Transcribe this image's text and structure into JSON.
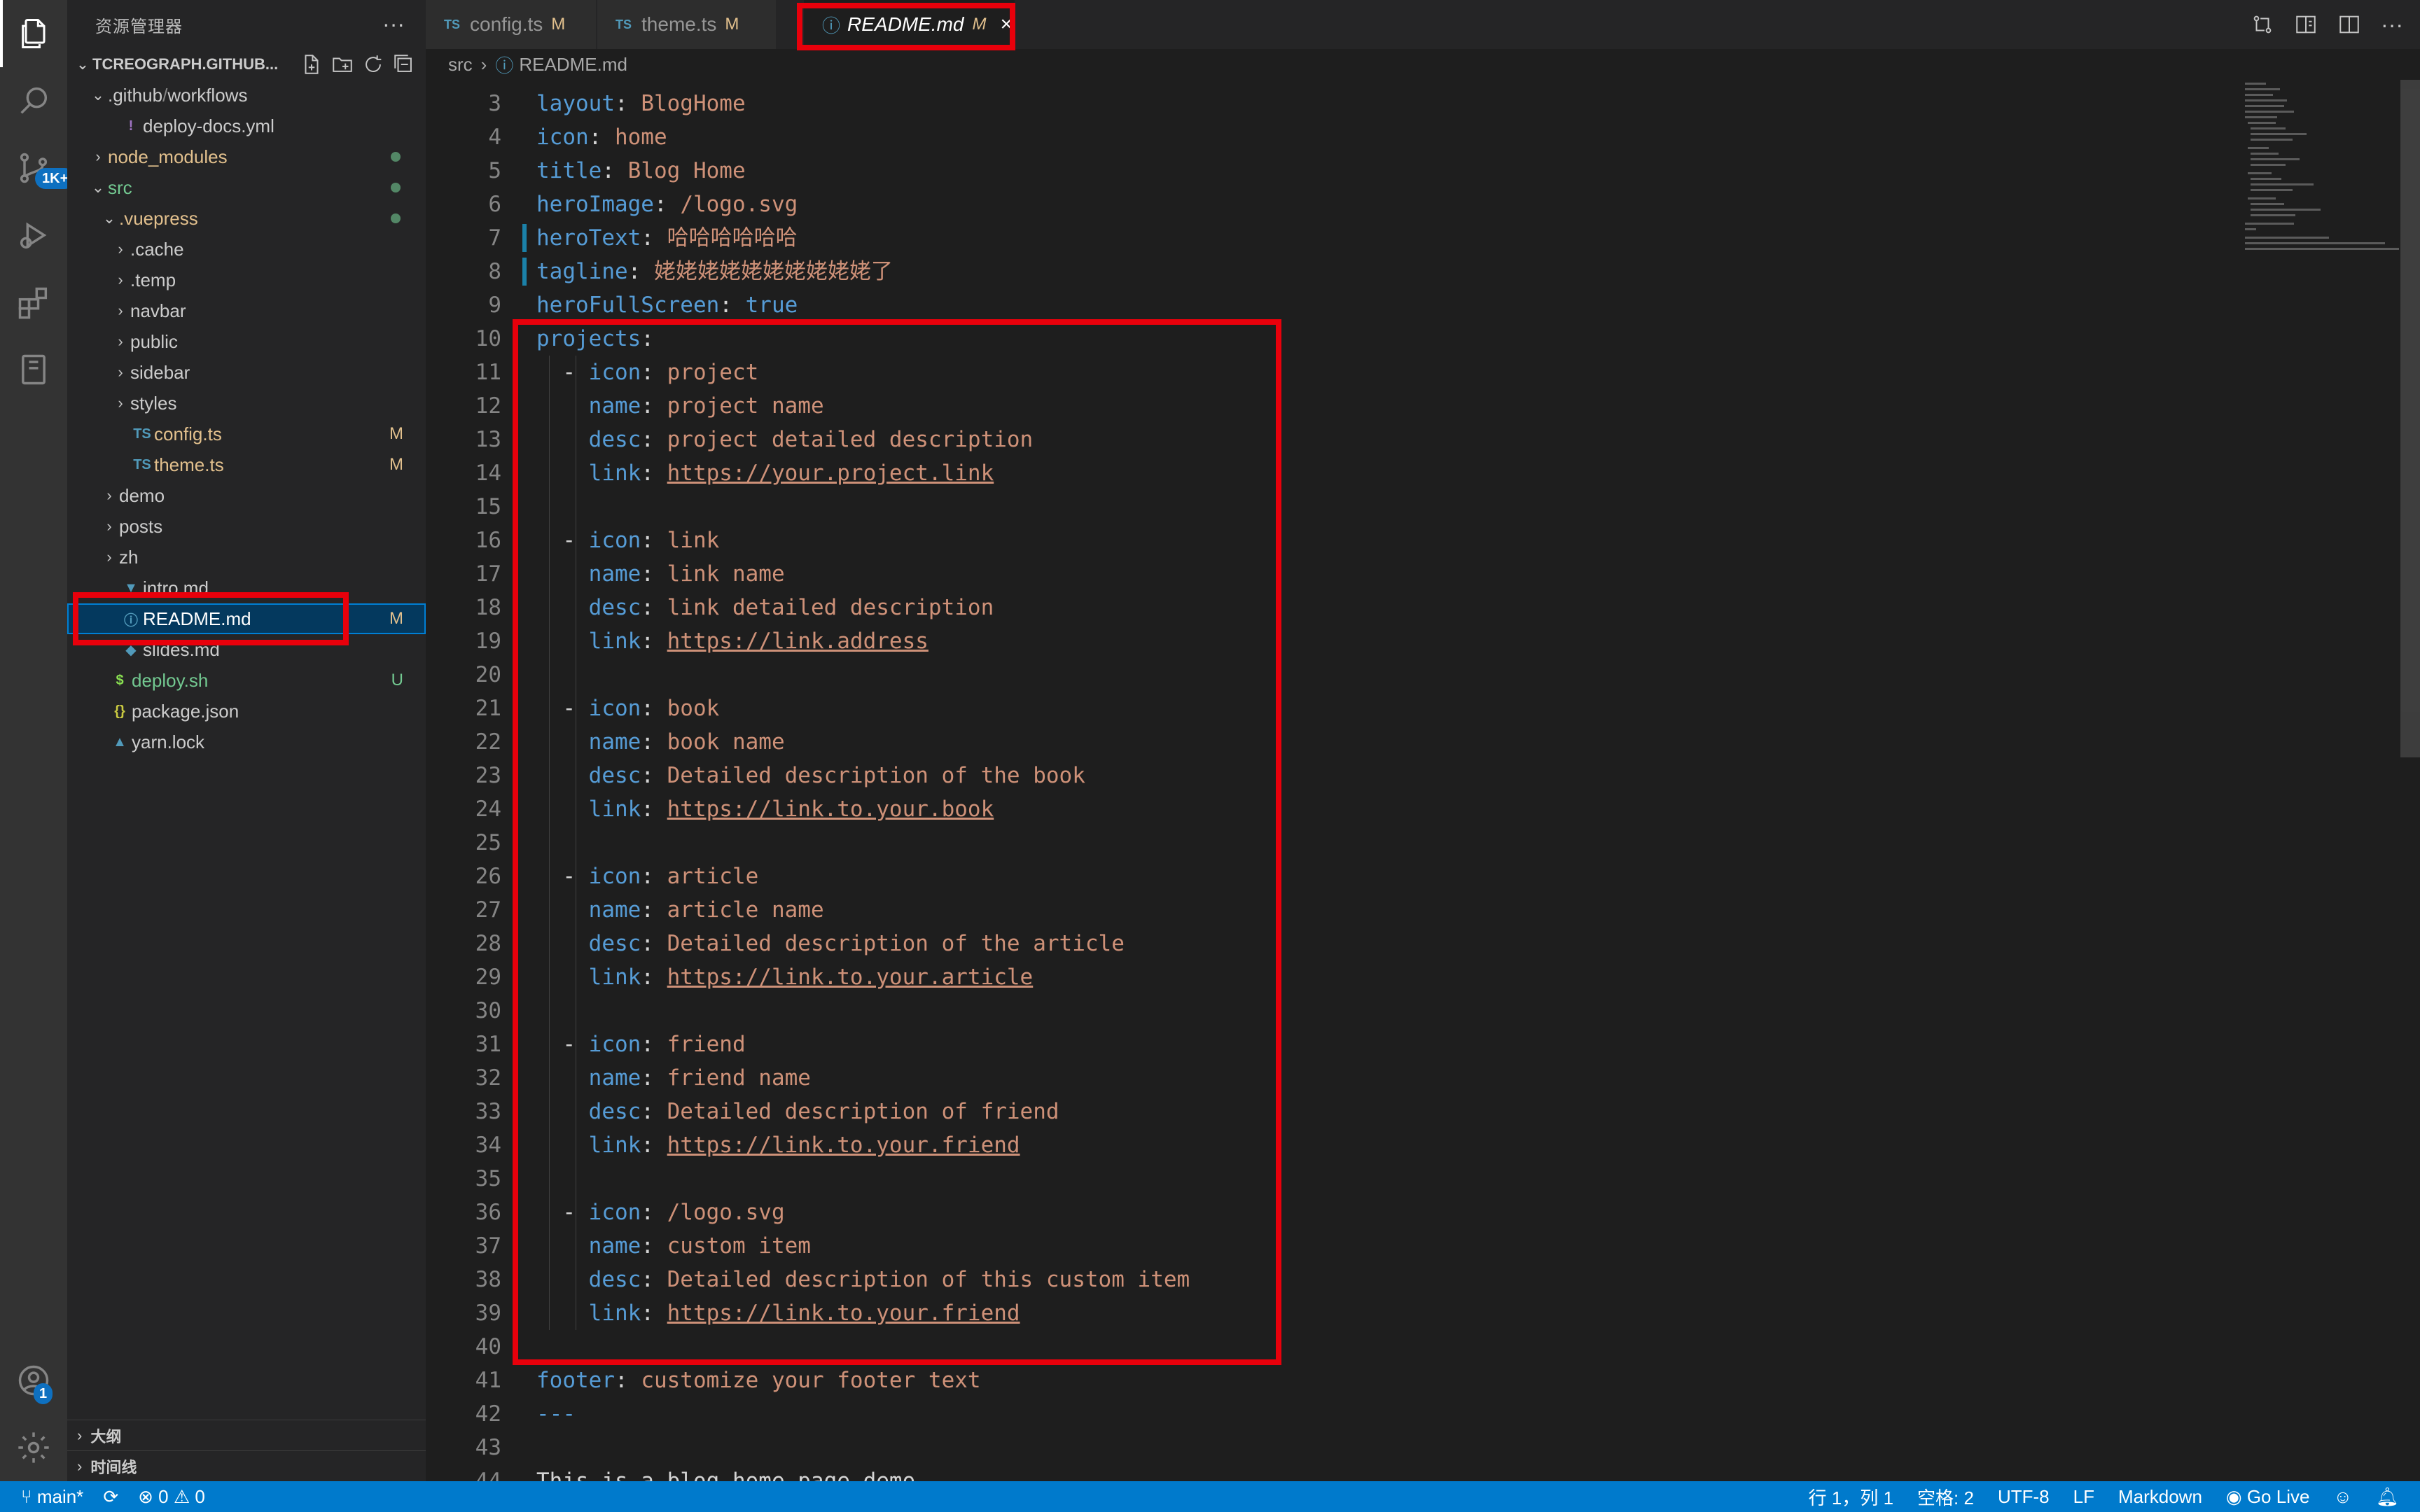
{
  "sidebar": {
    "title": "资源管理器",
    "more": "···",
    "root": "TCREOGRAPH.GITHUB...",
    "tree": [
      {
        "label": ".github",
        "label2": "workflows",
        "indent": 1,
        "chev": "v",
        "icon": "",
        "color": "#cccccc"
      },
      {
        "label": "deploy-docs.yml",
        "indent": 2,
        "chev": "",
        "icon": "!",
        "iconColor": "#a074c4",
        "color": "#cccccc"
      },
      {
        "label": "node_modules",
        "indent": 1,
        "chev": ">",
        "icon": "",
        "color": "#e2c08d",
        "dot": true
      },
      {
        "label": "src",
        "indent": 1,
        "chev": "v",
        "icon": "",
        "color": "#73c991",
        "dot": true
      },
      {
        "label": ".vuepress",
        "indent": 2,
        "chev": "v",
        "icon": "",
        "color": "#e2c08d",
        "dot": true
      },
      {
        "label": ".cache",
        "indent": 3,
        "chev": ">",
        "icon": "",
        "color": "#cccccc"
      },
      {
        "label": ".temp",
        "indent": 3,
        "chev": ">",
        "icon": "",
        "color": "#cccccc"
      },
      {
        "label": "navbar",
        "indent": 3,
        "chev": ">",
        "icon": "",
        "color": "#cccccc"
      },
      {
        "label": "public",
        "indent": 3,
        "chev": ">",
        "icon": "",
        "color": "#cccccc"
      },
      {
        "label": "sidebar",
        "indent": 3,
        "chev": ">",
        "icon": "",
        "color": "#cccccc"
      },
      {
        "label": "styles",
        "indent": 3,
        "chev": ">",
        "icon": "",
        "color": "#cccccc"
      },
      {
        "label": "config.ts",
        "indent": 3,
        "chev": "",
        "icon": "TS",
        "iconColor": "#519aba",
        "color": "#e2c08d",
        "status": "M"
      },
      {
        "label": "theme.ts",
        "indent": 3,
        "chev": "",
        "icon": "TS",
        "iconColor": "#519aba",
        "color": "#e2c08d",
        "status": "M"
      },
      {
        "label": "demo",
        "indent": 2,
        "chev": ">",
        "icon": "",
        "color": "#cccccc"
      },
      {
        "label": "posts",
        "indent": 2,
        "chev": ">",
        "icon": "",
        "color": "#cccccc"
      },
      {
        "label": "zh",
        "indent": 2,
        "chev": ">",
        "icon": "",
        "color": "#cccccc"
      },
      {
        "label": "intro.md",
        "indent": 2,
        "chev": "",
        "icon": "▼",
        "iconColor": "#519aba",
        "color": "#cccccc"
      },
      {
        "label": "README.md",
        "indent": 2,
        "chev": "",
        "icon": "ⓘ",
        "iconColor": "#519aba",
        "color": "#ffffff",
        "status": "M",
        "selected": true
      },
      {
        "label": "slides.md",
        "indent": 2,
        "chev": "",
        "icon": "◆",
        "iconColor": "#519aba",
        "color": "#cccccc"
      },
      {
        "label": "deploy.sh",
        "indent": 1,
        "chev": "",
        "icon": "$",
        "iconColor": "#89e051",
        "color": "#73c991",
        "status": "U"
      },
      {
        "label": "package.json",
        "indent": 1,
        "chev": "",
        "icon": "{}",
        "iconColor": "#cbcb41",
        "color": "#cccccc"
      },
      {
        "label": "yarn.lock",
        "indent": 1,
        "chev": "",
        "icon": "▲",
        "iconColor": "#519aba",
        "color": "#cccccc"
      }
    ],
    "outline": "大纲",
    "timeline": "时间线"
  },
  "activity": {
    "scm_badge": "1K+",
    "account_badge": "1"
  },
  "tabs": [
    {
      "label": "config.ts",
      "flag": "M",
      "type": "TS"
    },
    {
      "label": "theme.ts",
      "flag": "M",
      "type": "TS"
    },
    {
      "label": "README.md",
      "flag": "M",
      "type": "info",
      "active": true,
      "close": "×"
    }
  ],
  "breadcrumb": {
    "folder": "src",
    "file": "README.md"
  },
  "editor": {
    "lines": [
      {
        "n": "3",
        "t": [
          [
            "k",
            "layout"
          ],
          [
            "p",
            ": "
          ],
          [
            "v",
            "BlogHome"
          ]
        ]
      },
      {
        "n": "4",
        "t": [
          [
            "k",
            "icon"
          ],
          [
            "p",
            ": "
          ],
          [
            "v",
            "home"
          ]
        ]
      },
      {
        "n": "5",
        "t": [
          [
            "k",
            "title"
          ],
          [
            "p",
            ": "
          ],
          [
            "v",
            "Blog Home"
          ]
        ]
      },
      {
        "n": "6",
        "t": [
          [
            "k",
            "heroImage"
          ],
          [
            "p",
            ": "
          ],
          [
            "v",
            "/logo.svg"
          ]
        ]
      },
      {
        "n": "7",
        "t": [
          [
            "k",
            "heroText"
          ],
          [
            "p",
            ": "
          ],
          [
            "v",
            "哈哈哈哈哈哈"
          ]
        ],
        "mod": true
      },
      {
        "n": "8",
        "t": [
          [
            "k",
            "tagline"
          ],
          [
            "p",
            ": "
          ],
          [
            "v",
            "姥姥姥姥姥姥姥姥姥姥了"
          ]
        ],
        "mod": true
      },
      {
        "n": "9",
        "t": [
          [
            "k",
            "heroFullScreen"
          ],
          [
            "p",
            ": "
          ],
          [
            "k",
            "true"
          ]
        ]
      },
      {
        "n": "10",
        "t": [
          [
            "k",
            "projects"
          ],
          [
            "p",
            ":"
          ]
        ]
      },
      {
        "n": "11",
        "t": [
          [
            "p",
            "  "
          ],
          [
            "dash",
            "- "
          ],
          [
            "k",
            "icon"
          ],
          [
            "p",
            ": "
          ],
          [
            "v",
            "project"
          ]
        ]
      },
      {
        "n": "12",
        "t": [
          [
            "p",
            "    "
          ],
          [
            "k",
            "name"
          ],
          [
            "p",
            ": "
          ],
          [
            "v",
            "project name"
          ]
        ]
      },
      {
        "n": "13",
        "t": [
          [
            "p",
            "    "
          ],
          [
            "k",
            "desc"
          ],
          [
            "p",
            ": "
          ],
          [
            "v",
            "project detailed description"
          ]
        ]
      },
      {
        "n": "14",
        "t": [
          [
            "p",
            "    "
          ],
          [
            "k",
            "link"
          ],
          [
            "p",
            ": "
          ],
          [
            "u",
            "https://your.project.link"
          ]
        ]
      },
      {
        "n": "15",
        "t": []
      },
      {
        "n": "16",
        "t": [
          [
            "p",
            "  "
          ],
          [
            "dash",
            "- "
          ],
          [
            "k",
            "icon"
          ],
          [
            "p",
            ": "
          ],
          [
            "v",
            "link"
          ]
        ]
      },
      {
        "n": "17",
        "t": [
          [
            "p",
            "    "
          ],
          [
            "k",
            "name"
          ],
          [
            "p",
            ": "
          ],
          [
            "v",
            "link name"
          ]
        ]
      },
      {
        "n": "18",
        "t": [
          [
            "p",
            "    "
          ],
          [
            "k",
            "desc"
          ],
          [
            "p",
            ": "
          ],
          [
            "v",
            "link detailed description"
          ]
        ]
      },
      {
        "n": "19",
        "t": [
          [
            "p",
            "    "
          ],
          [
            "k",
            "link"
          ],
          [
            "p",
            ": "
          ],
          [
            "u",
            "https://link.address"
          ]
        ]
      },
      {
        "n": "20",
        "t": []
      },
      {
        "n": "21",
        "t": [
          [
            "p",
            "  "
          ],
          [
            "dash",
            "- "
          ],
          [
            "k",
            "icon"
          ],
          [
            "p",
            ": "
          ],
          [
            "v",
            "book"
          ]
        ]
      },
      {
        "n": "22",
        "t": [
          [
            "p",
            "    "
          ],
          [
            "k",
            "name"
          ],
          [
            "p",
            ": "
          ],
          [
            "v",
            "book name"
          ]
        ]
      },
      {
        "n": "23",
        "t": [
          [
            "p",
            "    "
          ],
          [
            "k",
            "desc"
          ],
          [
            "p",
            ": "
          ],
          [
            "v",
            "Detailed description of the book"
          ]
        ]
      },
      {
        "n": "24",
        "t": [
          [
            "p",
            "    "
          ],
          [
            "k",
            "link"
          ],
          [
            "p",
            ": "
          ],
          [
            "u",
            "https://link.to.your.book"
          ]
        ]
      },
      {
        "n": "25",
        "t": []
      },
      {
        "n": "26",
        "t": [
          [
            "p",
            "  "
          ],
          [
            "dash",
            "- "
          ],
          [
            "k",
            "icon"
          ],
          [
            "p",
            ": "
          ],
          [
            "v",
            "article"
          ]
        ]
      },
      {
        "n": "27",
        "t": [
          [
            "p",
            "    "
          ],
          [
            "k",
            "name"
          ],
          [
            "p",
            ": "
          ],
          [
            "v",
            "article name"
          ]
        ]
      },
      {
        "n": "28",
        "t": [
          [
            "p",
            "    "
          ],
          [
            "k",
            "desc"
          ],
          [
            "p",
            ": "
          ],
          [
            "v",
            "Detailed description of the article"
          ]
        ]
      },
      {
        "n": "29",
        "t": [
          [
            "p",
            "    "
          ],
          [
            "k",
            "link"
          ],
          [
            "p",
            ": "
          ],
          [
            "u",
            "https://link.to.your.article"
          ]
        ]
      },
      {
        "n": "30",
        "t": []
      },
      {
        "n": "31",
        "t": [
          [
            "p",
            "  "
          ],
          [
            "dash",
            "- "
          ],
          [
            "k",
            "icon"
          ],
          [
            "p",
            ": "
          ],
          [
            "v",
            "friend"
          ]
        ]
      },
      {
        "n": "32",
        "t": [
          [
            "p",
            "    "
          ],
          [
            "k",
            "name"
          ],
          [
            "p",
            ": "
          ],
          [
            "v",
            "friend name"
          ]
        ]
      },
      {
        "n": "33",
        "t": [
          [
            "p",
            "    "
          ],
          [
            "k",
            "desc"
          ],
          [
            "p",
            ": "
          ],
          [
            "v",
            "Detailed description of friend"
          ]
        ]
      },
      {
        "n": "34",
        "t": [
          [
            "p",
            "    "
          ],
          [
            "k",
            "link"
          ],
          [
            "p",
            ": "
          ],
          [
            "u",
            "https://link.to.your.friend"
          ]
        ]
      },
      {
        "n": "35",
        "t": []
      },
      {
        "n": "36",
        "t": [
          [
            "p",
            "  "
          ],
          [
            "dash",
            "- "
          ],
          [
            "k",
            "icon"
          ],
          [
            "p",
            ": "
          ],
          [
            "v",
            "/logo.svg"
          ]
        ]
      },
      {
        "n": "37",
        "t": [
          [
            "p",
            "    "
          ],
          [
            "k",
            "name"
          ],
          [
            "p",
            ": "
          ],
          [
            "v",
            "custom item"
          ]
        ]
      },
      {
        "n": "38",
        "t": [
          [
            "p",
            "    "
          ],
          [
            "k",
            "desc"
          ],
          [
            "p",
            ": "
          ],
          [
            "v",
            "Detailed description of this custom item"
          ]
        ]
      },
      {
        "n": "39",
        "t": [
          [
            "p",
            "    "
          ],
          [
            "k",
            "link"
          ],
          [
            "p",
            ": "
          ],
          [
            "u",
            "https://link.to.your.friend"
          ]
        ]
      },
      {
        "n": "40",
        "t": []
      },
      {
        "n": "41",
        "t": [
          [
            "k",
            "footer"
          ],
          [
            "p",
            ": "
          ],
          [
            "v",
            "customize your footer text"
          ]
        ]
      },
      {
        "n": "42",
        "t": [
          [
            "k",
            "---"
          ]
        ]
      },
      {
        "n": "43",
        "t": []
      },
      {
        "n": "44",
        "t": [
          [
            "p",
            "This is a blog home page demo."
          ]
        ]
      }
    ]
  },
  "statusbar": {
    "branch": "main*",
    "errors": "0",
    "warnings": "0",
    "position": "行 1，列 1",
    "spaces": "空格: 2",
    "encoding": "UTF-8",
    "eol": "LF",
    "language": "Markdown",
    "golive": "Go Live"
  },
  "colors": {
    "accent": "#007acc",
    "highlight_box": "#e8000b",
    "modified": "#e2c08d",
    "untracked": "#73c991"
  }
}
